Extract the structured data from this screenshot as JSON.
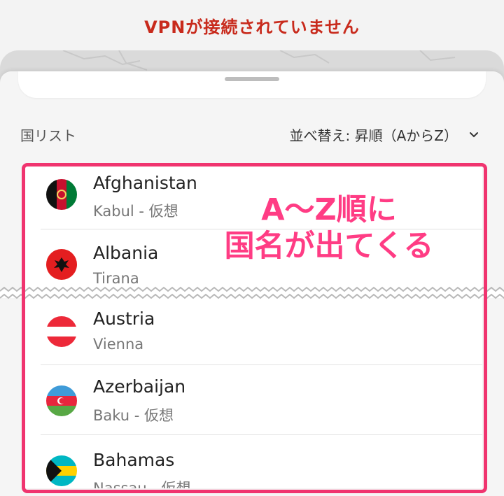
{
  "header": {
    "status": "VPNが接続されていません"
  },
  "section": {
    "title": "国リスト"
  },
  "sort": {
    "label": "並べ替え: 昇順（AからZ）",
    "chevron_icon": "chevron-down-icon"
  },
  "countries": [
    {
      "name": "Afghanistan",
      "city": "Kabul - 仮想"
    },
    {
      "name": "Albania",
      "city": "Tirana"
    },
    {
      "name": "Austria",
      "city": "Vienna"
    },
    {
      "name": "Azerbaijan",
      "city": "Baku - 仮想"
    },
    {
      "name": "Bahamas",
      "city": "Nassau - 仮想"
    }
  ],
  "annotation": {
    "text": "A～Z順に\n国名が出てくる",
    "color": "#ff3c84"
  },
  "colors": {
    "status_red": "#c82a1c",
    "highlight_pink": "#f0346f"
  }
}
